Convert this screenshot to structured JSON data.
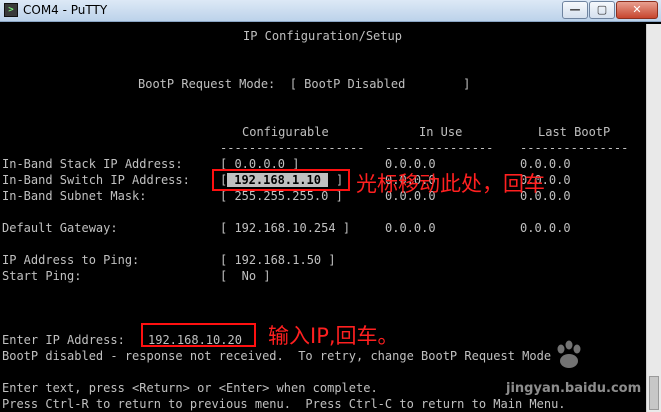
{
  "window": {
    "title": "COM4 - PuTTY",
    "icon": "putty-terminal-icon",
    "minimize_glyph": "—",
    "maximize_glyph": "▢",
    "close_glyph": "✕"
  },
  "terminal": {
    "lines": [
      {
        "id": "header",
        "text": "IP Configuration/Setup"
      },
      {
        "id": "bootp_mode",
        "text": "BootP Request Mode:  [ BootP Disabled        ]"
      },
      {
        "id": "col_configurable",
        "text": "Configurable"
      },
      {
        "id": "col_in_use",
        "text": "In Use"
      },
      {
        "id": "col_last_bootp",
        "text": "Last BootP"
      },
      {
        "id": "dashes_1",
        "text": "--------------------"
      },
      {
        "id": "dashes_2",
        "text": "---------------"
      },
      {
        "id": "dashes_3",
        "text": "---------------"
      },
      {
        "id": "stack_label",
        "text": "In-Band Stack IP Address:"
      },
      {
        "id": "stack_cfg",
        "text": "[ 0.0.0.0 ]"
      },
      {
        "id": "stack_inuse",
        "text": "0.0.0.0"
      },
      {
        "id": "stack_last",
        "text": "0.0.0.0"
      },
      {
        "id": "switch_label",
        "text": "In-Band Switch IP Address:"
      },
      {
        "id": "switch_cfg_open",
        "text": "["
      },
      {
        "id": "switch_cfg_value",
        "text": " 192.168.1.10 "
      },
      {
        "id": "switch_cfg_close",
        "text": "]"
      },
      {
        "id": "switch_inuse",
        "text": "0.0.0.0"
      },
      {
        "id": "switch_last",
        "text": "0.0.0.0"
      },
      {
        "id": "mask_label",
        "text": "In-Band Subnet Mask:"
      },
      {
        "id": "mask_cfg",
        "text": "[ 255.255.255.0 ]"
      },
      {
        "id": "mask_inuse",
        "text": "0.0.0.0"
      },
      {
        "id": "mask_last",
        "text": "0.0.0.0"
      },
      {
        "id": "gw_label",
        "text": "Default Gateway:"
      },
      {
        "id": "gw_cfg",
        "text": "[ 192.168.10.254 ]"
      },
      {
        "id": "gw_inuse",
        "text": "0.0.0.0"
      },
      {
        "id": "gw_last",
        "text": "0.0.0.0"
      },
      {
        "id": "ping_label",
        "text": "IP Address to Ping:"
      },
      {
        "id": "ping_cfg",
        "text": "[ 192.168.1.50 ]"
      },
      {
        "id": "startping_label",
        "text": "Start Ping:"
      },
      {
        "id": "startping_cfg",
        "text": "[  No ]"
      },
      {
        "id": "enter_ip_label",
        "text": "Enter IP Address:"
      },
      {
        "id": "enter_ip_value",
        "text": "192.168.10.20"
      },
      {
        "id": "bootp_msg",
        "text": "BootP disabled - response not received.  To retry, change BootP Request Mode"
      },
      {
        "id": "help_1",
        "text": "Enter text, press <Return> or <Enter> when complete."
      },
      {
        "id": "help_2",
        "text": "Press Ctrl-R to return to previous menu.  Press Ctrl-C to return to Main Menu."
      }
    ]
  },
  "annotations": {
    "step1": "光标移动此处，回车",
    "step2": "输入IP,回车。"
  },
  "watermark": {
    "text": "jingyan.baidu.com",
    "icon": "baidu-paw-icon"
  },
  "colors": {
    "terminal_bg": "#000000",
    "terminal_fg": "#c0c0c0",
    "annotation": "#ff2020"
  }
}
